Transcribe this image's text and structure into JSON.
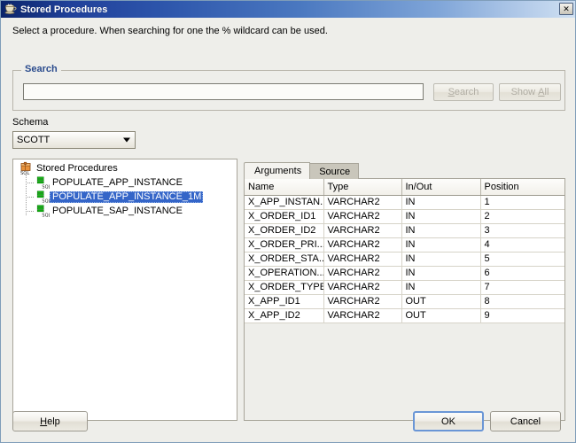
{
  "window": {
    "title": "Stored Procedures",
    "title_icon": "coffee-cup-icon",
    "close_label": "✕"
  },
  "instruction": "Select a procedure. When searching for one the % wildcard can be used.",
  "search": {
    "legend": "Search",
    "value": "",
    "placeholder": "",
    "search_button": "Search",
    "search_button_accel": "S",
    "show_all_button": "Show All",
    "show_all_button_accel": "A",
    "buttons_enabled": false
  },
  "schema": {
    "label": "Schema",
    "selected": "SCOTT"
  },
  "tree": {
    "root_label": "Stored Procedures",
    "root_icon": "stored-procedures-folder-icon",
    "items": [
      {
        "label": "POPULATE_APP_INSTANCE",
        "icon": "sql-procedure-icon",
        "selected": false
      },
      {
        "label": "POPULATE_APP_INSTANCE_1M",
        "icon": "sql-procedure-icon",
        "selected": true
      },
      {
        "label": "POPULATE_SAP_INSTANCE",
        "icon": "sql-procedure-icon",
        "selected": false
      }
    ]
  },
  "tabs": [
    {
      "label": "Arguments",
      "active": true
    },
    {
      "label": "Source",
      "active": false
    }
  ],
  "arguments_table": {
    "columns": [
      "Name",
      "Type",
      "In/Out",
      "Position"
    ],
    "rows": [
      [
        "X_APP_INSTAN...",
        "VARCHAR2",
        "IN",
        "1"
      ],
      [
        "X_ORDER_ID1",
        "VARCHAR2",
        "IN",
        "2"
      ],
      [
        "X_ORDER_ID2",
        "VARCHAR2",
        "IN",
        "3"
      ],
      [
        "X_ORDER_PRI...",
        "VARCHAR2",
        "IN",
        "4"
      ],
      [
        "X_ORDER_STA...",
        "VARCHAR2",
        "IN",
        "5"
      ],
      [
        "X_OPERATION...",
        "VARCHAR2",
        "IN",
        "6"
      ],
      [
        "X_ORDER_TYPE",
        "VARCHAR2",
        "IN",
        "7"
      ],
      [
        "X_APP_ID1",
        "VARCHAR2",
        "OUT",
        "8"
      ],
      [
        "X_APP_ID2",
        "VARCHAR2",
        "OUT",
        "9"
      ]
    ]
  },
  "footer": {
    "help_label": "Help",
    "help_accel": "H",
    "ok_label": "OK",
    "cancel_label": "Cancel",
    "default_button": "OK"
  },
  "colors": {
    "titlebar_start": "#0a246a",
    "titlebar_end": "#cfe0f2",
    "dialog_background": "#eeeeea",
    "selection_blue": "#3465c8",
    "legend_blue": "#2a4b8d",
    "focus_border": "#6a96d6"
  }
}
